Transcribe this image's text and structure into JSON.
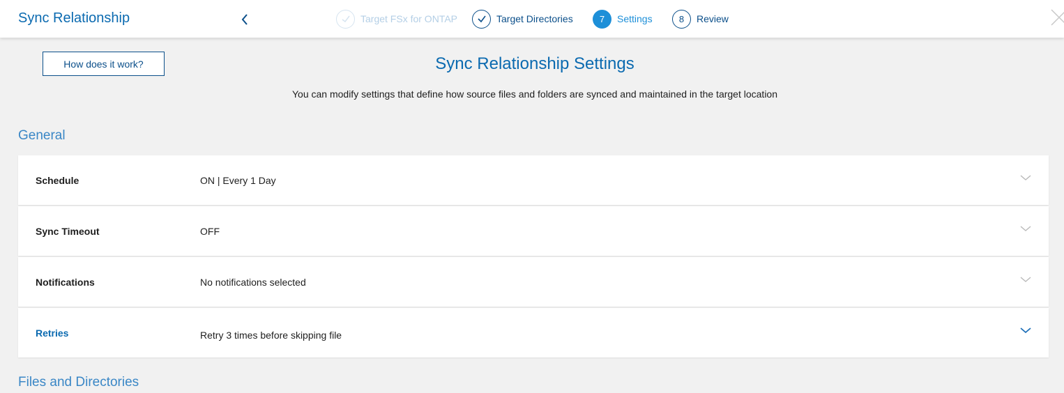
{
  "header": {
    "title": "Sync Relationship",
    "steps": [
      {
        "label": "Target FSx for ONTAP",
        "state": "faded"
      },
      {
        "label": "Target Directories",
        "state": "done"
      },
      {
        "number": "7",
        "label": "Settings",
        "state": "active"
      },
      {
        "number": "8",
        "label": "Review",
        "state": "upcoming"
      }
    ]
  },
  "main": {
    "how_button": "How does it work?",
    "title": "Sync Relationship Settings",
    "subtitle": "You can modify settings that define how source files and folders are synced and maintained in the target location",
    "sections": [
      {
        "title": "General",
        "rows": [
          {
            "label": "Schedule",
            "value": "ON | Every 1 Day"
          },
          {
            "label": "Sync Timeout",
            "value": "OFF"
          },
          {
            "label": "Notifications",
            "value": "No notifications selected"
          },
          {
            "label": "Retries",
            "value": "Retry 3 times before skipping file"
          }
        ]
      },
      {
        "title": "Files and Directories"
      }
    ]
  },
  "colors": {
    "brand_blue": "#0b6ab0",
    "dark_blue": "#0b4f8a",
    "active_step": "#1d8fd8",
    "background": "#f1f1f1"
  },
  "icons": {
    "back": "chevron-left-icon",
    "close": "close-icon",
    "done": "check-icon",
    "expand": "chevron-down-icon"
  }
}
